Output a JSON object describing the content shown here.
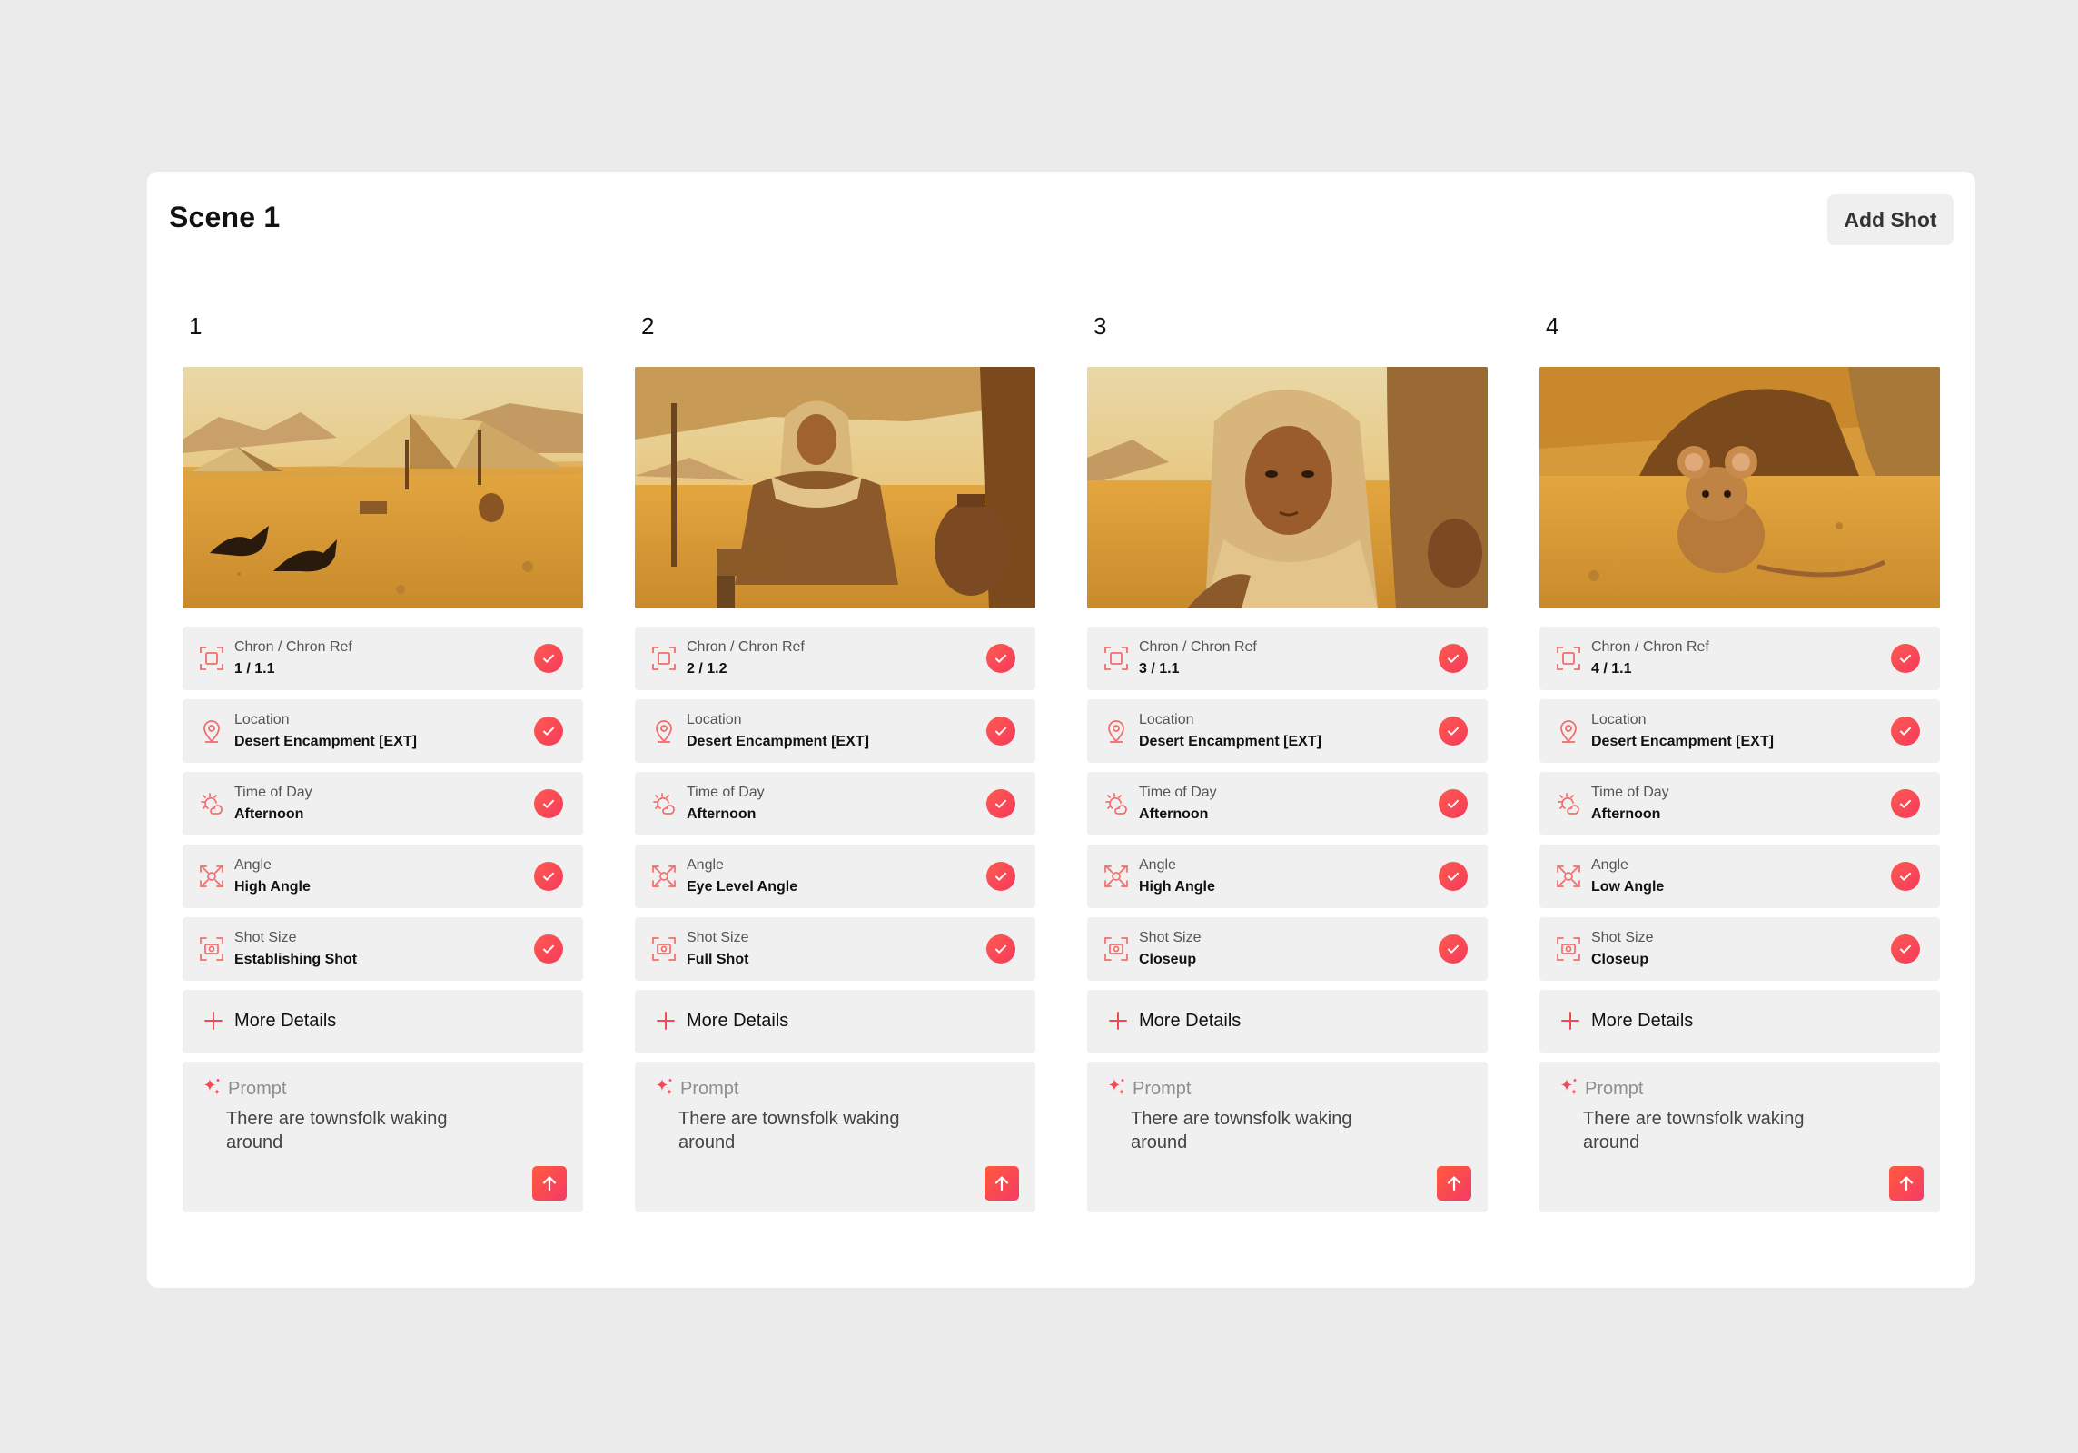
{
  "scene": {
    "title": "Scene 1",
    "add_shot_label": "Add Shot"
  },
  "field_labels": {
    "chron": "Chron / Chron Ref",
    "location": "Location",
    "time": "Time of Day",
    "angle": "Angle",
    "shot_size": "Shot Size"
  },
  "more_details_label": "More Details",
  "prompt_label": "Prompt",
  "accent_colors": {
    "check": "#f4485a",
    "send": "#ff5a3c",
    "icon": "#f26d6d"
  },
  "shots": [
    {
      "number": "1",
      "image": "desert-tents-with-crows",
      "chron": "1 / 1.1",
      "location": "Desert Encampment [EXT]",
      "time": "Afternoon",
      "angle": "High Angle",
      "shot_size": "Establishing Shot",
      "prompt": "There are townsfolk waking around"
    },
    {
      "number": "2",
      "image": "woman-sitting-under-tent",
      "chron": "2 / 1.2",
      "location": "Desert Encampment [EXT]",
      "time": "Afternoon",
      "angle": "Eye Level Angle",
      "shot_size": "Full Shot",
      "prompt": "There are townsfolk waking around"
    },
    {
      "number": "3",
      "image": "woman-closeup-headscarf",
      "chron": "3 / 1.1",
      "location": "Desert Encampment [EXT]",
      "time": "Afternoon",
      "angle": "High Angle",
      "shot_size": "Closeup",
      "prompt": "There are townsfolk waking around"
    },
    {
      "number": "4",
      "image": "desert-mouse",
      "chron": "4 / 1.1",
      "location": "Desert Encampment [EXT]",
      "time": "Afternoon",
      "angle": "Low Angle",
      "shot_size": "Closeup",
      "prompt": "There are townsfolk waking around"
    }
  ]
}
